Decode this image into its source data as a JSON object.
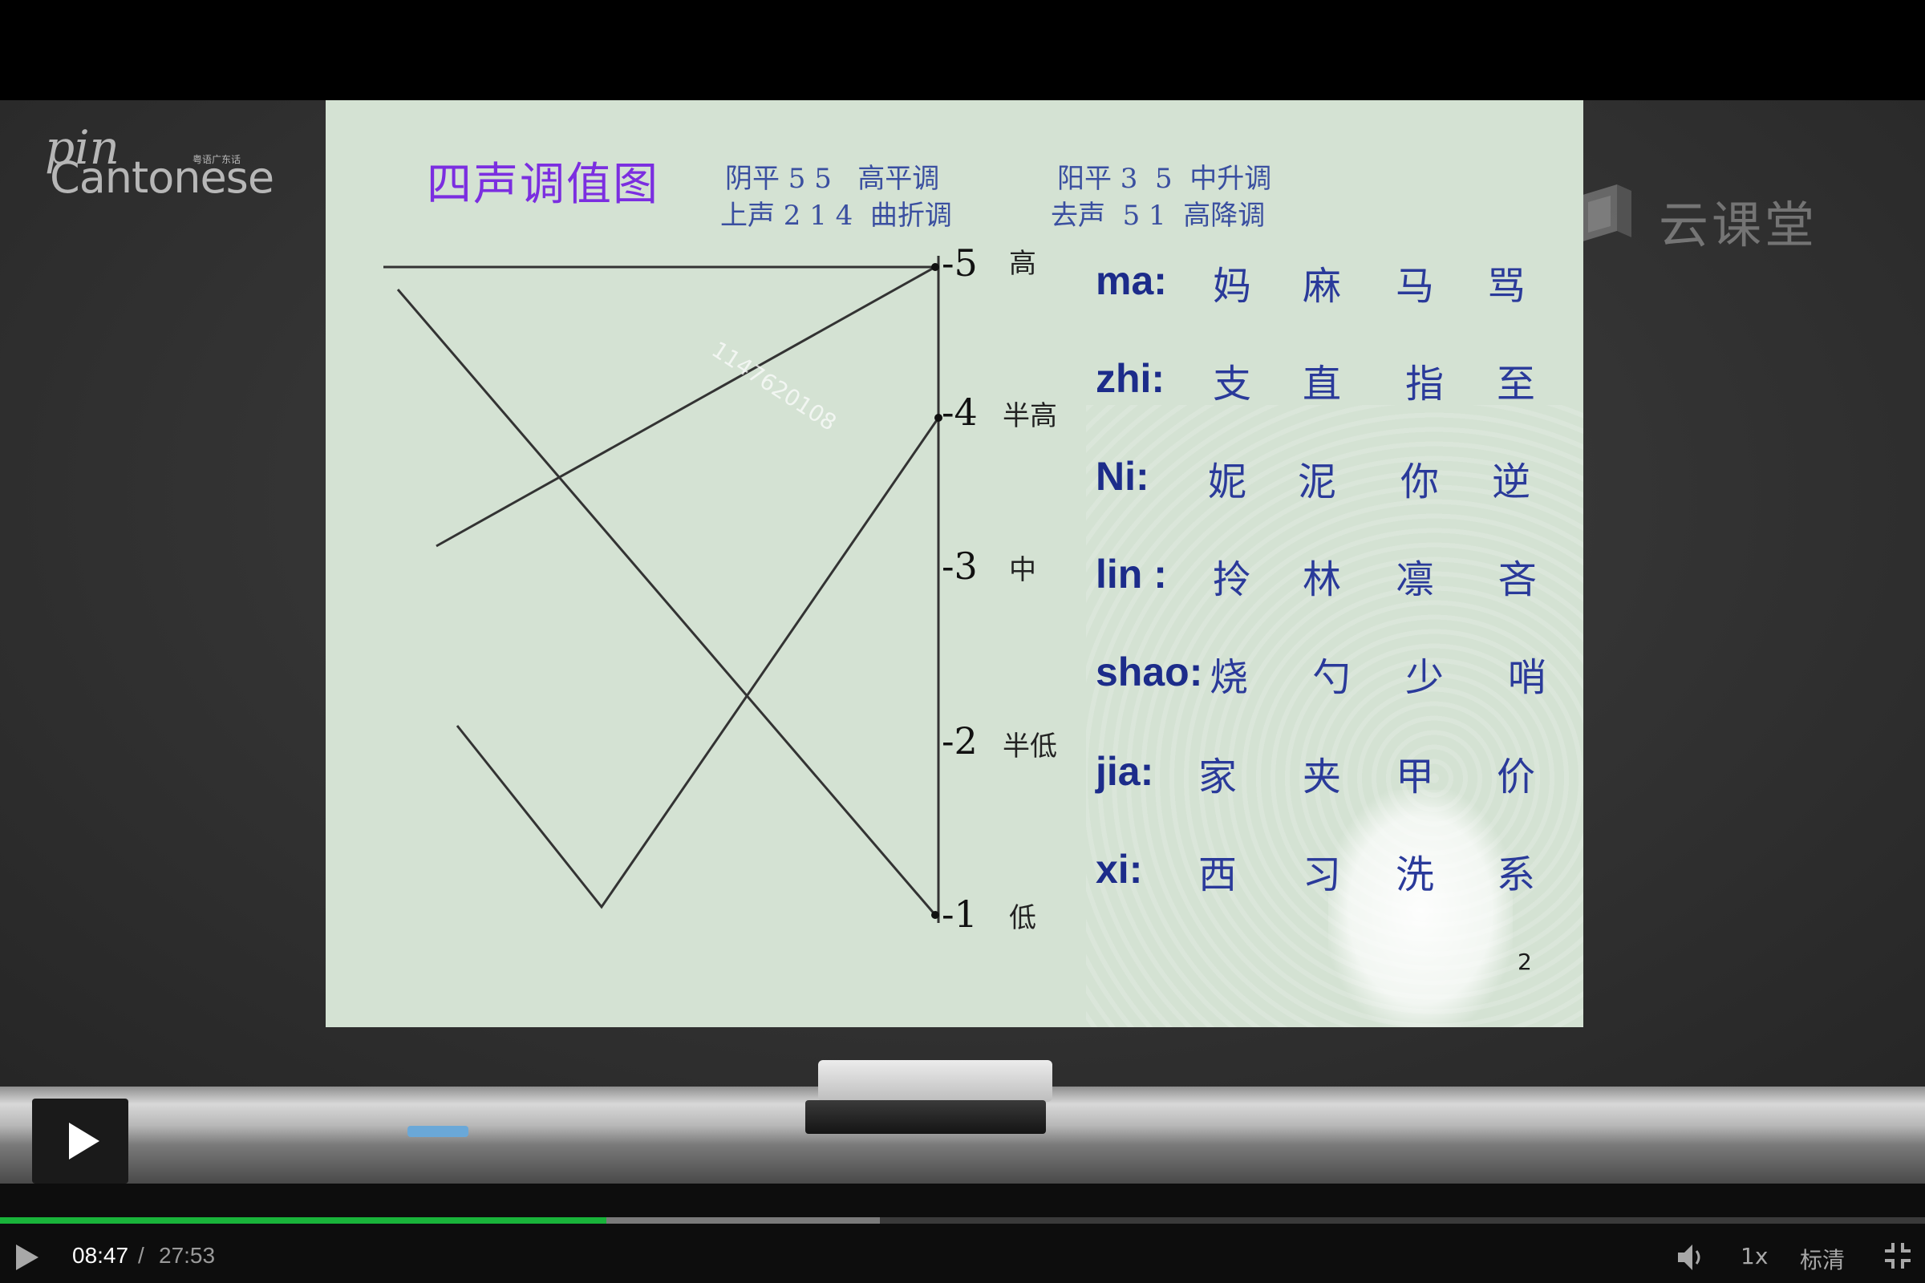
{
  "logo": {
    "line1": "pin",
    "line2": "Cantonese",
    "sub": "粤语广东话"
  },
  "watermark": {
    "text": "云课堂",
    "icon": "cloud-classroom-icon"
  },
  "slide": {
    "title": "四声调值图",
    "legend": [
      "阴平 5 5   高平调",
      "阳平 3  5  中升调",
      "上声 2 1 4  曲折调",
      "去声  5 1  高降调"
    ],
    "scale": [
      {
        "num": "-5",
        "name": "高"
      },
      {
        "num": "-4",
        "name": "半高"
      },
      {
        "num": "-3",
        "name": "中"
      },
      {
        "num": "-2",
        "name": "半低"
      },
      {
        "num": "-1",
        "name": "低"
      }
    ],
    "overlay_id": "1147620108",
    "rows": [
      {
        "syl": "ma:",
        "chars": [
          "妈",
          "麻",
          "马",
          "骂"
        ]
      },
      {
        "syl": "zhi:",
        "chars": [
          "支",
          "直",
          "指",
          "至"
        ]
      },
      {
        "syl": "Ni:",
        "chars": [
          "妮",
          "泥",
          "你",
          "逆"
        ]
      },
      {
        "syl": "lin :",
        "chars": [
          "拎",
          "林",
          "凛",
          "吝"
        ]
      },
      {
        "syl": "shao:",
        "chars": [
          "烧",
          "勺",
          "少",
          "哨"
        ]
      },
      {
        "syl": "jia:",
        "chars": [
          "家",
          "夹",
          "甲",
          "价"
        ]
      },
      {
        "syl": "xi:",
        "chars": [
          "西",
          "习",
          "洗",
          "系"
        ]
      }
    ],
    "page_number": "2"
  },
  "player": {
    "current_time": "08:47",
    "separator": "/",
    "total_time": "27:53",
    "played_fraction": 0.315,
    "buffered_fraction": 0.457,
    "speed": "1x",
    "quality": "标清",
    "accent": "#19b33a"
  }
}
